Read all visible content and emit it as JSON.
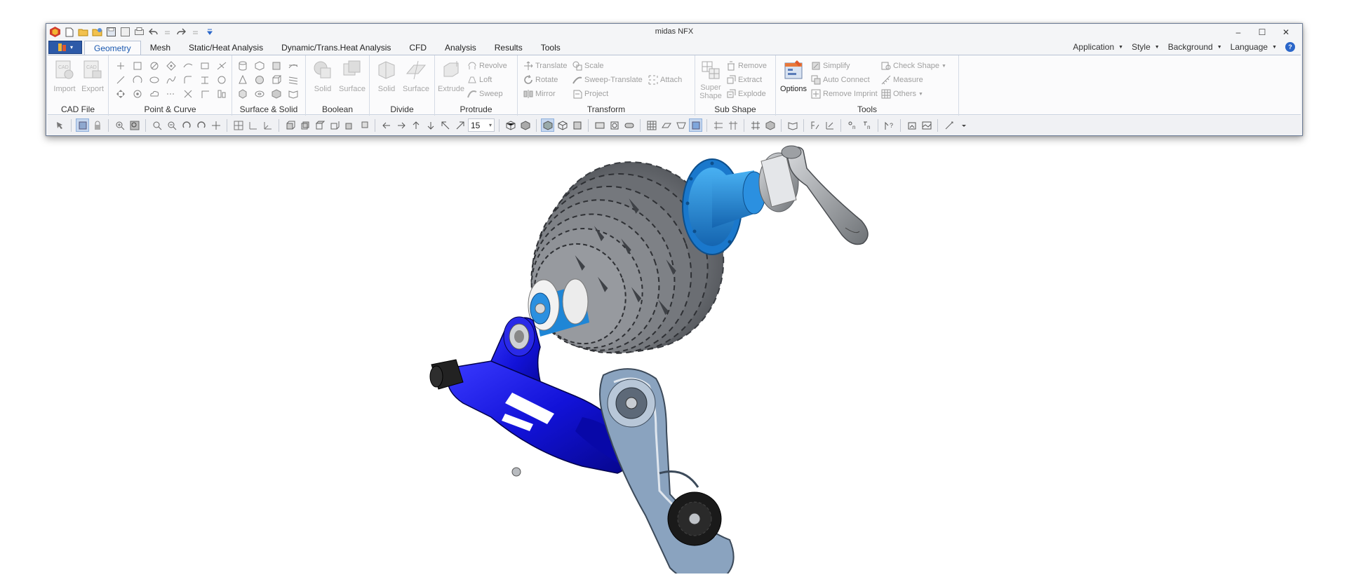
{
  "window": {
    "title": "midas NFX",
    "controls": [
      "–",
      "☐",
      "✕"
    ]
  },
  "tabs": [
    "Geometry",
    "Mesh",
    "Static/Heat Analysis",
    "Dynamic/Trans.Heat Analysis",
    "CFD",
    "Analysis",
    "Results",
    "Tools"
  ],
  "active_tab": "Geometry",
  "right_menus": [
    "Application",
    "Style",
    "Background",
    "Language"
  ],
  "ribbon": {
    "cad_file": {
      "label": "CAD File",
      "import": "Import",
      "export": "Export"
    },
    "point_curve": {
      "label": "Point & Curve"
    },
    "surface_solid": {
      "label": "Surface & Solid"
    },
    "boolean": {
      "label": "Boolean",
      "solid": "Solid",
      "surface": "Surface"
    },
    "divide": {
      "label": "Divide",
      "solid": "Solid",
      "surface": "Surface"
    },
    "protrude": {
      "label": "Protrude",
      "extrude": "Extrude",
      "revolve": "Revolve",
      "loft": "Loft",
      "sweep": "Sweep"
    },
    "transform": {
      "label": "Transform",
      "translate": "Translate",
      "rotate": "Rotate",
      "mirror": "Mirror",
      "scale": "Scale",
      "sweep_translate": "Sweep-Translate",
      "project": "Project",
      "attach": "Attach"
    },
    "sub_shape": {
      "label": "Sub Shape",
      "super_shape_1": "Super",
      "super_shape_2": "Shape",
      "remove": "Remove",
      "extract": "Extract",
      "explode": "Explode"
    },
    "tools": {
      "label": "Tools",
      "options": "Options",
      "simplify": "Simplify",
      "auto_connect": "Auto Connect",
      "remove_imprint": "Remove Imprint",
      "check_shape": "Check Shape",
      "measure": "Measure",
      "others": "Others"
    }
  },
  "toolbar": {
    "zoom_value": "15"
  },
  "colors": {
    "accent": "#1b59b0",
    "app_button": "#2d5aa8",
    "part_blue": "#1212d8",
    "hub_blue": "#1e8fe0",
    "metal_gray": "#7a7d82"
  }
}
